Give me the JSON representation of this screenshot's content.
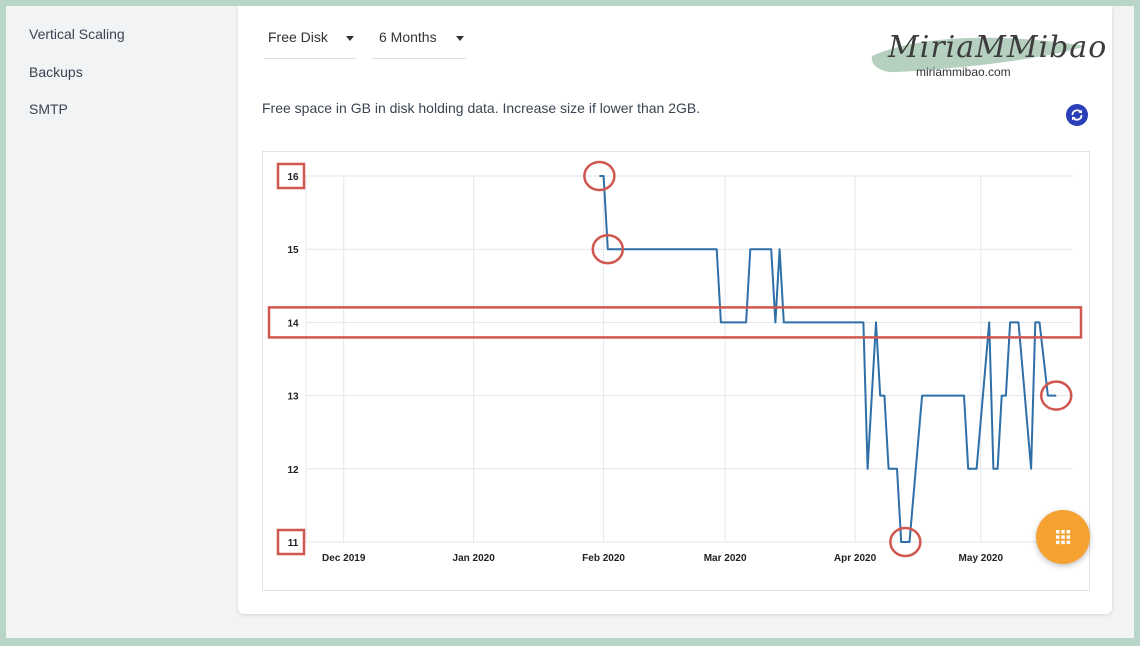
{
  "sidebar": {
    "items": [
      {
        "label": "Vertical Scaling"
      },
      {
        "label": "Backups"
      },
      {
        "label": "SMTP"
      }
    ]
  },
  "controls": {
    "metric_select": {
      "value": "Free Disk"
    },
    "range_select": {
      "value": "6 Months"
    }
  },
  "description": "Free space in GB in disk holding data. Increase size if lower than 2GB.",
  "watermark": {
    "title": "MiriaMMibao",
    "url": "miriammibao.com"
  },
  "colors": {
    "line": "#2f6fa8",
    "annotation": "#d0574f",
    "fab": "#f5a233",
    "refresh": "#2b3fb8"
  },
  "chart_data": {
    "type": "line",
    "x_ticks": [
      "Dec 2019",
      "Jan 2020",
      "Feb 2020",
      "Mar 2020",
      "Apr 2020",
      "May 2020"
    ],
    "y_ticks": [
      16,
      15,
      14,
      13,
      12,
      11
    ],
    "ylim": [
      11,
      16
    ],
    "xlim": [
      "2019-11-22",
      "2020-05-23"
    ],
    "grid": true,
    "series": [
      {
        "x": [
          "2020-01-31",
          "2020-02-01",
          "2020-02-02",
          "2020-02-28",
          "2020-02-29",
          "2020-03-06",
          "2020-03-07",
          "2020-03-12",
          "2020-03-13",
          "2020-03-14",
          "2020-03-15",
          "2020-04-03",
          "2020-04-04",
          "2020-04-06",
          "2020-04-07",
          "2020-04-08",
          "2020-04-09",
          "2020-04-11",
          "2020-04-12",
          "2020-04-13",
          "2020-04-14",
          "2020-04-17",
          "2020-04-18",
          "2020-04-27",
          "2020-04-28",
          "2020-04-29",
          "2020-04-30",
          "2020-05-03",
          "2020-05-04",
          "2020-05-05",
          "2020-05-06",
          "2020-05-07",
          "2020-05-08",
          "2020-05-09",
          "2020-05-10",
          "2020-05-13",
          "2020-05-14",
          "2020-05-15",
          "2020-05-17",
          "2020-05-18",
          "2020-05-19"
        ],
        "y": [
          16,
          16,
          15,
          15,
          14,
          14,
          15,
          15,
          14,
          15,
          14,
          14,
          12,
          14,
          13,
          13,
          12,
          12,
          11,
          11,
          11,
          13,
          13,
          13,
          12,
          12,
          12,
          14,
          12,
          12,
          13,
          13,
          14,
          14,
          14,
          12,
          14,
          14,
          13,
          13,
          13
        ]
      }
    ],
    "annotations": {
      "circles": [
        {
          "x": "2020-01-31",
          "y": 16
        },
        {
          "x": "2020-02-02",
          "y": 15
        },
        {
          "x": "2020-04-13",
          "y": 11
        },
        {
          "x": "2020-05-19",
          "y": 13
        }
      ],
      "boxes": [
        {
          "label": 16
        },
        {
          "label": 11
        },
        {
          "band_y": 14
        }
      ]
    }
  }
}
